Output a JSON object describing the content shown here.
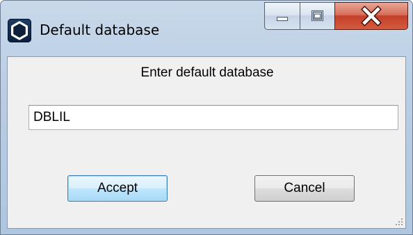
{
  "window": {
    "title": "Default database",
    "icon": "app-hexagon-icon",
    "caption_buttons": [
      "minimize-icon",
      "maximize-icon",
      "close-icon"
    ]
  },
  "dialog": {
    "prompt": "Enter default database",
    "input_value": "DBLIL",
    "accept_label": "Accept",
    "cancel_label": "Cancel"
  },
  "colors": {
    "title_bar": "#b9cde3",
    "client_background": "#f0f0f0",
    "close_button": "#c4402a",
    "default_button_border": "#3c7fb1"
  }
}
